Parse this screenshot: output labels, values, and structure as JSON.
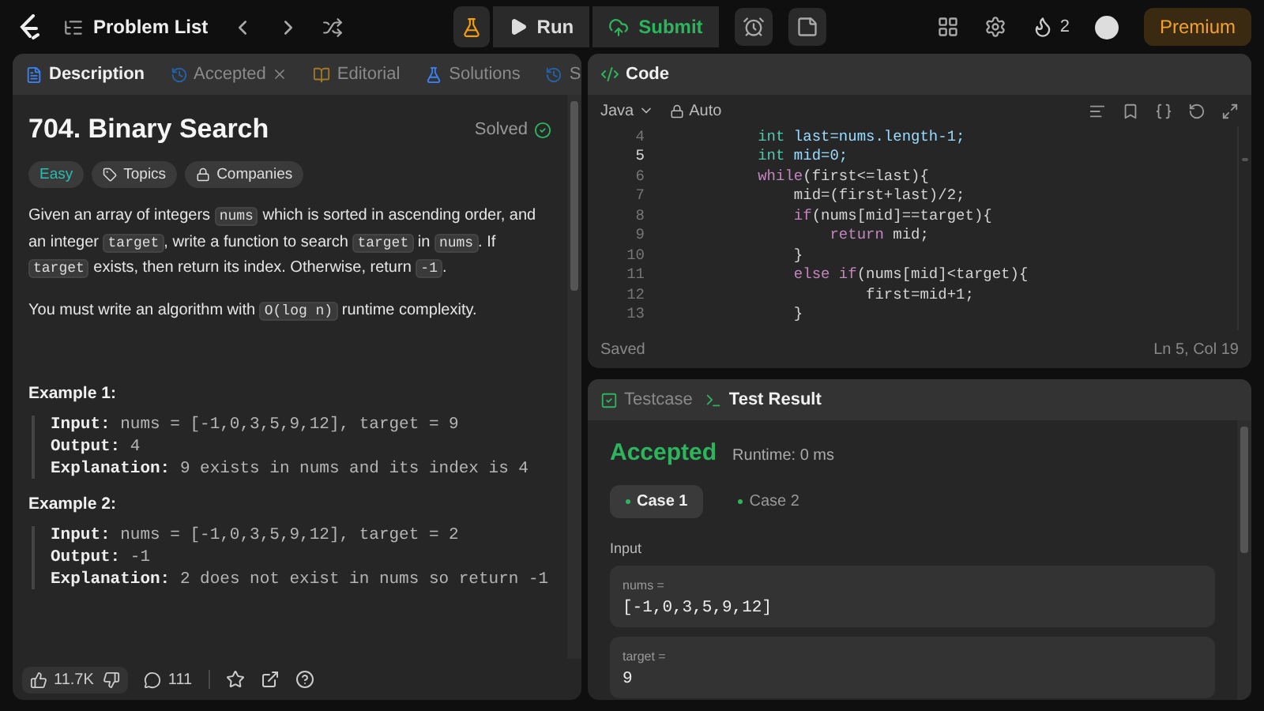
{
  "topbar": {
    "problem_list": "Problem List",
    "run": "Run",
    "submit": "Submit",
    "streak": "2",
    "premium": "Premium"
  },
  "description_panel": {
    "tabs": [
      {
        "label": "Description",
        "selected": true,
        "kind": "description",
        "closable": false
      },
      {
        "label": "Accepted",
        "selected": false,
        "kind": "accepted",
        "closable": true
      },
      {
        "label": "Editorial",
        "selected": false,
        "kind": "editorial",
        "closable": false
      },
      {
        "label": "Solutions",
        "selected": false,
        "kind": "solutions",
        "closable": false
      },
      {
        "label": "S",
        "selected": false,
        "kind": "accepted",
        "closable": false
      }
    ],
    "title": "704. Binary Search",
    "status": "Solved",
    "tags": [
      {
        "label": "Easy",
        "kind": "difficulty"
      },
      {
        "label": "Topics",
        "kind": "topics"
      },
      {
        "label": "Companies",
        "kind": "companies"
      }
    ],
    "paragraphs": [
      [
        {
          "kind": "text",
          "text": "Given an array of integers "
        },
        {
          "kind": "code",
          "text": "nums"
        },
        {
          "kind": "text",
          "text": " which is sorted in ascending order, and an integer "
        },
        {
          "kind": "code",
          "text": "target"
        },
        {
          "kind": "text",
          "text": ", write a function to search "
        },
        {
          "kind": "code",
          "text": "target"
        },
        {
          "kind": "text",
          "text": " in "
        },
        {
          "kind": "code",
          "text": "nums"
        },
        {
          "kind": "text",
          "text": ". If "
        },
        {
          "kind": "code",
          "text": "target"
        },
        {
          "kind": "text",
          "text": " exists, then return its index. Otherwise, return "
        },
        {
          "kind": "code",
          "text": "-1"
        },
        {
          "kind": "text",
          "text": "."
        }
      ],
      [
        {
          "kind": "text",
          "text": "You must write an algorithm with "
        },
        {
          "kind": "code",
          "text": "O(log n)"
        },
        {
          "kind": "text",
          "text": " runtime complexity."
        }
      ]
    ],
    "examples": [
      {
        "title": "Example 1:",
        "lines": [
          {
            "label": "Input:",
            "value": "nums = [-1,0,3,5,9,12], target = 9"
          },
          {
            "label": "Output:",
            "value": "4"
          },
          {
            "label": "Explanation:",
            "value": "9 exists in nums and its index is 4"
          }
        ]
      },
      {
        "title": "Example 2:",
        "lines": [
          {
            "label": "Input:",
            "value": "nums = [-1,0,3,5,9,12], target = 2"
          },
          {
            "label": "Output:",
            "value": "-1"
          },
          {
            "label": "Explanation:",
            "value": "2 does not exist in nums so return -1"
          }
        ]
      }
    ],
    "footer": {
      "likes": "11.7K",
      "comments": "111"
    }
  },
  "code_panel": {
    "title": "Code",
    "language": "Java",
    "mode": "Auto",
    "lines": [
      {
        "number": "4",
        "current": false,
        "tokens": [
          {
            "kind": "type",
            "text": "        int"
          },
          {
            "kind": "var",
            "text": " last=nums.length-1;"
          }
        ]
      },
      {
        "number": "5",
        "current": true,
        "tokens": [
          {
            "kind": "type",
            "text": "        int"
          },
          {
            "kind": "var",
            "text": " mid=0;"
          }
        ]
      },
      {
        "number": "6",
        "current": false,
        "tokens": [
          {
            "kind": "control",
            "text": "        while"
          },
          {
            "kind": "plain",
            "text": "(first<=last){"
          }
        ]
      },
      {
        "number": "7",
        "current": false,
        "tokens": [
          {
            "kind": "plain",
            "text": "            mid=(first+last)/2;"
          }
        ]
      },
      {
        "number": "8",
        "current": false,
        "tokens": [
          {
            "kind": "control",
            "text": "            if"
          },
          {
            "kind": "plain",
            "text": "(nums[mid]==target){"
          }
        ]
      },
      {
        "number": "9",
        "current": false,
        "tokens": [
          {
            "kind": "control",
            "text": "                return"
          },
          {
            "kind": "plain",
            "text": " mid;"
          }
        ]
      },
      {
        "number": "10",
        "current": false,
        "tokens": [
          {
            "kind": "plain",
            "text": "            }"
          }
        ]
      },
      {
        "number": "11",
        "current": false,
        "tokens": [
          {
            "kind": "control",
            "text": "            else if"
          },
          {
            "kind": "plain",
            "text": "(nums[mid]<target){"
          }
        ]
      },
      {
        "number": "12",
        "current": false,
        "tokens": [
          {
            "kind": "plain",
            "text": "                    first=mid+1;"
          }
        ]
      },
      {
        "number": "13",
        "current": false,
        "tokens": [
          {
            "kind": "plain",
            "text": "            }"
          }
        ]
      }
    ],
    "saved": "Saved",
    "cursor": "Ln 5, Col 19"
  },
  "result_panel": {
    "tabs": [
      {
        "label": "Testcase",
        "selected": false,
        "kind": "testcase"
      },
      {
        "label": "Test Result",
        "selected": true,
        "kind": "result"
      }
    ],
    "verdict": "Accepted",
    "runtime": "Runtime: 0 ms",
    "cases": [
      {
        "label": "Case 1",
        "selected": true
      },
      {
        "label": "Case 2",
        "selected": false
      }
    ],
    "input_label": "Input",
    "inputs": [
      {
        "name": "nums =",
        "value": "[-1,0,3,5,9,12]"
      },
      {
        "name": "target =",
        "value": "9"
      }
    ]
  }
}
